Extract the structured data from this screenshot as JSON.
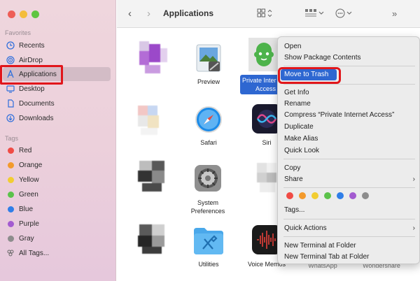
{
  "sidebar": {
    "favorites_label": "Favorites",
    "items": [
      {
        "label": "Recents",
        "icon": "clock-icon"
      },
      {
        "label": "AirDrop",
        "icon": "airdrop-icon"
      },
      {
        "label": "Applications",
        "icon": "applications-icon"
      },
      {
        "label": "Desktop",
        "icon": "desktop-icon"
      },
      {
        "label": "Documents",
        "icon": "document-icon"
      },
      {
        "label": "Downloads",
        "icon": "download-icon"
      }
    ],
    "tags_label": "Tags",
    "tags": [
      {
        "label": "Red",
        "color": "#f04b45"
      },
      {
        "label": "Orange",
        "color": "#f39a2c"
      },
      {
        "label": "Yellow",
        "color": "#f2cd31"
      },
      {
        "label": "Green",
        "color": "#5bc24a"
      },
      {
        "label": "Blue",
        "color": "#2f7ee8"
      },
      {
        "label": "Purple",
        "color": "#a35bd0"
      },
      {
        "label": "Gray",
        "color": "#8d8d8d"
      },
      {
        "label": "All Tags...",
        "color": ""
      }
    ]
  },
  "toolbar": {
    "title": "Applications",
    "back": "‹",
    "forward": "›"
  },
  "files": {
    "preview": "Preview",
    "vpn_line1": "Private Inter",
    "vpn_line2": "Access",
    "safari": "Safari",
    "siri": "Siri",
    "sysprefs_line1": "System",
    "sysprefs_line2": "Preferences",
    "utilities": "Utilities",
    "voice_memos": "Voice Memos",
    "whatsapp": "WhatsApp",
    "wondershare": "Wondershare"
  },
  "menu": {
    "open": "Open",
    "show_package": "Show Package Contents",
    "move_to_trash": "Move to Trash",
    "get_info": "Get Info",
    "rename": "Rename",
    "compress": "Compress “Private Internet Access”",
    "duplicate": "Duplicate",
    "make_alias": "Make Alias",
    "quick_look": "Quick Look",
    "copy": "Copy",
    "share": "Share",
    "tags": "Tags...",
    "quick_actions": "Quick Actions",
    "new_terminal": "New Terminal at Folder",
    "new_terminal_tab": "New Terminal Tab at Folder",
    "tag_colors": [
      "#f04b45",
      "#f39a2c",
      "#f2cd31",
      "#5bc24a",
      "#2f7ee8",
      "#a35bd0",
      "#8d8d8d"
    ]
  }
}
